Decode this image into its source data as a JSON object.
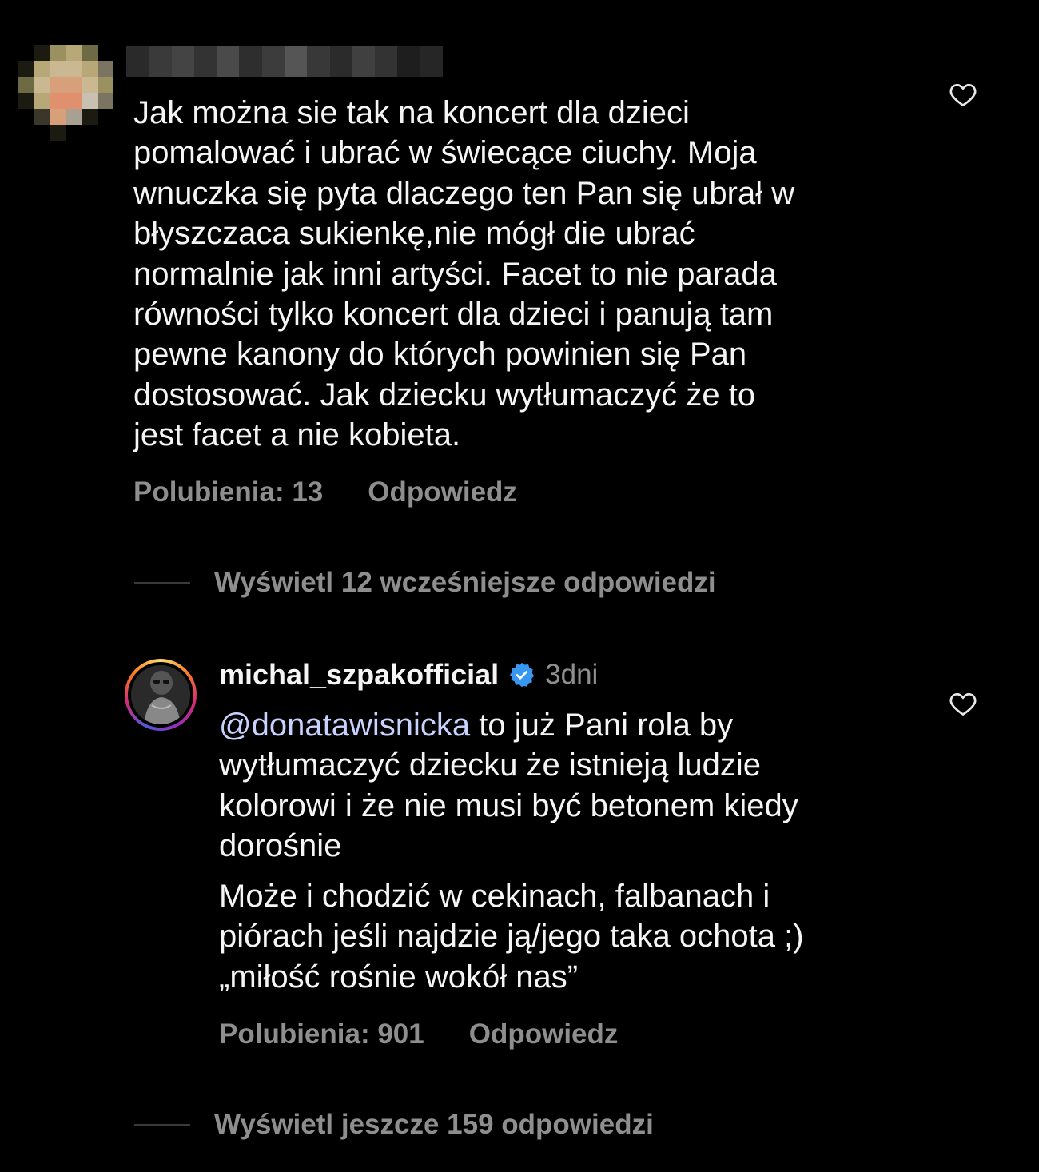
{
  "comment1": {
    "text": "Jak można sie tak na koncert dla dzieci\npomalować i ubrać w świecące ciuchy. Moja\nwnuczka się pyta dlaczego ten Pan się ubrał w\nbłyszczaca sukienkę,nie mógł die ubrać\nnormalnie jak inni artyści. Facet to nie parada\nrówności tylko koncert  dla dzieci i panują tam\npewne kanony do których powinien się Pan\ndostosować. Jak dziecku wytłumaczyć że to\njest facet a nie kobieta.",
    "likes": "Polubienia: 13",
    "reply": "Odpowiedz"
  },
  "view_earlier": "Wyświetl 12 wcześniejsze odpowiedzi",
  "comment2": {
    "username": "michal_szpakofficial",
    "time": "3dni",
    "mention": "@donatawisnicka",
    "text_after_mention": " to już Pani rola by\nwytłumaczyć dziecku że istnieją ludzie\nkolorowi i że nie musi być betonem kiedy\ndorośnie",
    "text2": "Może  i chodzić w cekinach, falbanach i\npiórach jeśli najdzie ją/jego taka ochota ;)\n„miłość rośnie wokół nas”",
    "likes": "Polubienia: 901",
    "reply": "Odpowiedz"
  },
  "view_more": "Wyświetl jeszcze 159 odpowiedzi",
  "colors": {
    "background": "#000000",
    "secondary_text": "#8e8e8e",
    "verified": "#3897f0"
  },
  "icons": [
    "heart-icon",
    "verified-badge-icon"
  ]
}
